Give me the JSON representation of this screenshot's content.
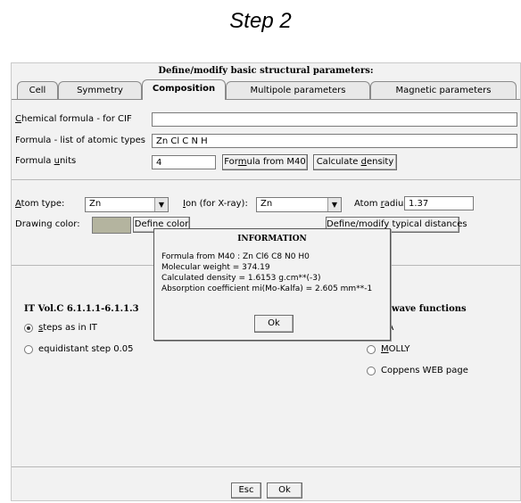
{
  "caption": "Step 2",
  "window": {
    "title": "Define/modify basic structural parameters:",
    "tabs": [
      {
        "label": "Cell",
        "active": false
      },
      {
        "label": "Symmetry",
        "active": false
      },
      {
        "label": "Composition",
        "active": true
      },
      {
        "label": "Multipole parameters",
        "active": false
      },
      {
        "label": "Magnetic parameters",
        "active": false
      }
    ]
  },
  "composition": {
    "chemical_formula_label_pre": "",
    "chemical_formula_label_u": "C",
    "chemical_formula_label_post": "hemical formula - for CIF",
    "chemical_formula_value": "",
    "atomic_types_label": "Formula - list of atomic types",
    "atomic_types_value": "Zn Cl C N H",
    "formula_units_label_pre": "Formula ",
    "formula_units_label_u": "u",
    "formula_units_label_post": "nits",
    "formula_units_value": "4",
    "btn_from_m40_pre": "For",
    "btn_from_m40_u": "m",
    "btn_from_m40_post": "ula from M40",
    "btn_density_pre": "Calculate ",
    "btn_density_u": "d",
    "btn_density_post": "ensity"
  },
  "atom": {
    "atom_type_label_pre": "",
    "atom_type_label_u": "A",
    "atom_type_label_post": "tom type:",
    "atom_type_value": "Zn",
    "ion_label_pre": "",
    "ion_label_u": "I",
    "ion_label_post": "on (for X-ray):",
    "ion_value": "Zn",
    "radius_label_pre": "Atom ",
    "radius_label_u": "r",
    "radius_label_post": "adius:",
    "radius_value": "1.37",
    "drawing_color_label": "Drawing color:",
    "drawing_color": "#b4b49f",
    "define_color_btn": "Define color",
    "distances_btn": "Define/modify typical distances"
  },
  "dialog": {
    "title": "INFORMATION",
    "lines": [
      "Formula from M40 : Zn Cl6 C8 N0 H0",
      "Molecular weight =  374.19",
      "Calculated density =  1.6153 g.cm**(-3)",
      "Absorption coefficient mi(Mo-Kalfa) =    2.605 mm**-1"
    ],
    "ok_label": "Ok"
  },
  "scattering": {
    "title": "IT Vol.C 6.1.1.1-6.1.1.3",
    "options": [
      {
        "pre": "",
        "u": "s",
        "post": "teps as in IT",
        "selected": true
      },
      {
        "pre": "equidistant step 0.05",
        "u": "",
        "post": "",
        "selected": false
      }
    ]
  },
  "wave": {
    "title": "wave functions",
    "options": [
      {
        "pre": "",
        "u": "N",
        "post": "A",
        "selected": false
      },
      {
        "pre": "",
        "u": "M",
        "post": "OLLY",
        "selected": false
      },
      {
        "pre": "Coppens WEB page",
        "u": "",
        "post": "",
        "selected": false
      }
    ]
  },
  "footer": {
    "esc_label": "Esc",
    "ok_label": "Ok"
  }
}
